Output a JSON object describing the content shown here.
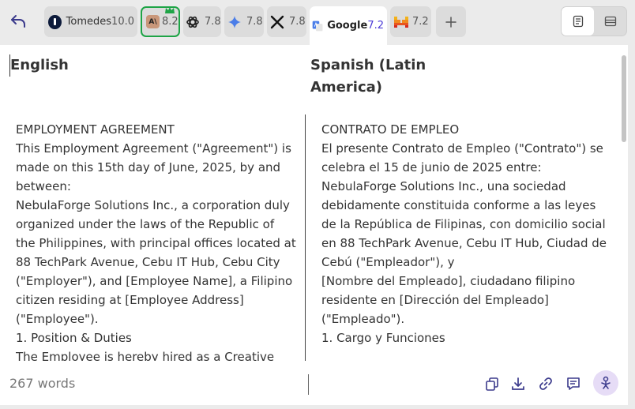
{
  "engines": [
    {
      "name": "Tomedes",
      "score": "10.0"
    },
    {
      "name": "",
      "score": "8.2"
    },
    {
      "name": "",
      "score": "7.8"
    },
    {
      "name": "",
      "score": "7.8"
    },
    {
      "name": "",
      "score": "7.8"
    },
    {
      "name": "Google",
      "score": "7.2"
    },
    {
      "name": "",
      "score": "7.2"
    }
  ],
  "logo_text": {
    "anthropic": "A\\"
  },
  "source": {
    "language": "English",
    "lines": [
      "EMPLOYMENT AGREEMENT",
      "This Employment Agreement (\"Agreement\") is made on this 15th day of June, 2025, by and between:",
      "NebulaForge Solutions Inc., a corporation duly organized under the laws of the Republic of the Philippines, with principal offices located at 88 TechPark Avenue, Cebu IT Hub, Cebu City (\"Employer\"), and [Employee Name], a Filipino citizen residing at [Employee Address] (\"Employee\").",
      "1. Position & Duties",
      "The Employee is hereby hired as a Creative"
    ]
  },
  "target": {
    "language": "Spanish (Latin America)",
    "lines": [
      "CONTRATO DE EMPLEO",
      "El presente Contrato de Empleo (\"Contrato\") se celebra el 15 de junio de 2025 entre:",
      "NebulaForge Solutions Inc., una sociedad debidamente constituida conforme a las leyes de la República de Filipinas, con domicilio social en 88 TechPark Avenue, Cebu IT Hub, Ciudad de Cebú (\"Empleador\"), y",
      "[Nombre del Empleado], ciudadano filipino residente en [Dirección del Empleado] (\"Empleado\").",
      "1. Cargo y Funciones"
    ]
  },
  "footer": {
    "word_count": "267 words"
  },
  "colors": {
    "accent": "#4a3ad6",
    "best_border": "#1ea446",
    "ai_button": "#e6dcf6"
  }
}
